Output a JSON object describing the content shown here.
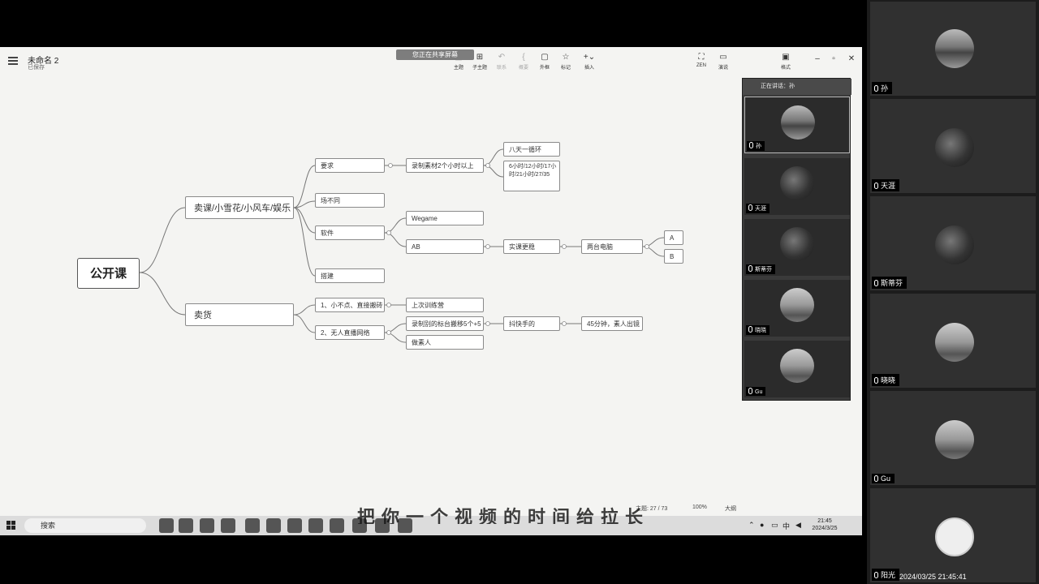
{
  "share_banner": "您正在共享屏幕",
  "doc": {
    "title": "未命名 2",
    "subtitle": "已保存"
  },
  "toolbar": [
    {
      "label": "主题",
      "glyph": "▤",
      "dim": false
    },
    {
      "label": "子主题",
      "glyph": "⊞",
      "dim": false
    },
    {
      "label": "联系",
      "glyph": "↶",
      "dim": true
    },
    {
      "label": "概要",
      "glyph": "{",
      "dim": true
    },
    {
      "label": "外框",
      "glyph": "▢",
      "dim": false
    },
    {
      "label": "标记",
      "glyph": "☆",
      "dim": false
    },
    {
      "label": "插入",
      "glyph": "+⌄",
      "dim": false
    },
    {
      "label": "ZEN",
      "glyph": "⛶",
      "dim": false
    },
    {
      "label": "演说",
      "glyph": "▭",
      "dim": false
    },
    {
      "label": "格式",
      "glyph": "▣",
      "dim": false
    }
  ],
  "mindmap": {
    "root": "公开课",
    "branch_a": "卖课/小雪花/小风车/娱乐",
    "branch_b": "卖货",
    "req": "要求",
    "req_detail": "录制素材2个小时以上",
    "req_note1": "八天一循环",
    "req_note2": "6小时/12小时/17小时/21小时/27/35",
    "diff": "场不同",
    "soft": "软件",
    "soft_a": "Wegame",
    "soft_b": "AB",
    "ab_1": "实课更稳",
    "ab_2": "两台电脑",
    "ab_a": "A",
    "ab_b": "B",
    "build": "搭建",
    "goods_1": "1、小不点、直接搬砖",
    "goods_1a": "上次训练营",
    "goods_2": "2、无人直播网络",
    "goods_2a": "录制别的标台搬移5个+5",
    "goods_2b": "做素人",
    "goods_2c": "抖快手的",
    "goods_2d": "45分钟，素人出镜"
  },
  "meeting_panel": {
    "title": "正在讲话：孙",
    "tiles": [
      "孙",
      "天涯",
      "斯蒂芬",
      "晓晓",
      "Gu"
    ]
  },
  "sidebar": {
    "tiles": [
      "孙",
      "天涯",
      "斯蒂芬",
      "晓晓",
      "Gu",
      "阳光"
    ]
  },
  "taskbar": {
    "search": "搜索",
    "time": "21:45",
    "date": "2024/3/25",
    "ime": "中"
  },
  "status": {
    "left": "主题: 27 / 73",
    "zoom": "100%",
    "mode": "大纲"
  },
  "subtitle": "把你一个视频的时间给拉长",
  "timestamp": "2024/03/25 21:45:41"
}
